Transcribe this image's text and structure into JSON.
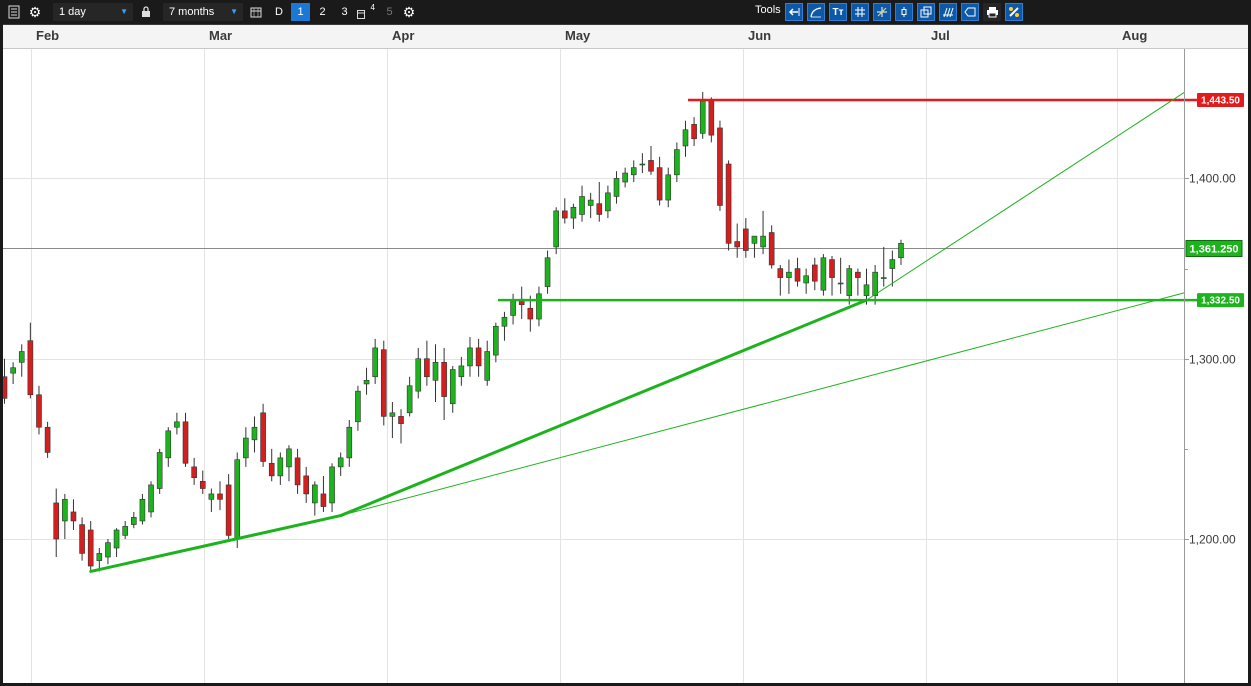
{
  "toolbar": {
    "interval": "1 day",
    "range": "7 months",
    "d_label": "D",
    "layouts": [
      "1",
      "2",
      "3",
      "4",
      "5"
    ],
    "tools_label": "Tools",
    "text_tool_label": "Tт",
    "icons": [
      "list-icon",
      "gear-icon",
      "lock-icon",
      "calendar-icon",
      "gear-icon",
      "arrow-left-icon",
      "curve-icon",
      "text-icon",
      "grid-icon",
      "crosshair-icon",
      "candle-icon",
      "window-icon",
      "fork-icon",
      "tag-icon",
      "print-icon",
      "settings-icon"
    ]
  },
  "chart_data": {
    "type": "candlestick",
    "x_axis_labels": [
      "Feb",
      "Mar",
      "Apr",
      "May",
      "Jun",
      "Jul",
      "Aug"
    ],
    "y_axis_labels": [
      "1,400.00",
      "1,300.00",
      "1,200.00"
    ],
    "y_ticks": [
      1400,
      1300,
      1200
    ],
    "ylim": [
      1111,
      1470
    ],
    "current_price_label": "1,361.250",
    "current_price": 1361.25,
    "horizontal_lines": [
      {
        "label": "1,443.50",
        "value": 1443.5,
        "color": "#e3191b"
      },
      {
        "label": "1,332.50",
        "value": 1332.5,
        "color": "#1db31d"
      }
    ],
    "colors": {
      "up": "#1db31d",
      "down": "#d41f1f",
      "wick": "#333333",
      "trend": "#1db31d",
      "grid": "#e3e3e3"
    },
    "candles_ohlc": [
      [
        1290,
        1300,
        1275,
        1278
      ],
      [
        1292,
        1298,
        1286,
        1295
      ],
      [
        1298,
        1308,
        1290,
        1304
      ],
      [
        1310,
        1320,
        1278,
        1280
      ],
      [
        1280,
        1285,
        1258,
        1262
      ],
      [
        1262,
        1265,
        1245,
        1248
      ],
      [
        1220,
        1228,
        1190,
        1200
      ],
      [
        1210,
        1225,
        1200,
        1222
      ],
      [
        1215,
        1222,
        1205,
        1210
      ],
      [
        1208,
        1212,
        1188,
        1192
      ],
      [
        1205,
        1210,
        1182,
        1185
      ],
      [
        1188,
        1195,
        1182,
        1192
      ],
      [
        1190,
        1200,
        1186,
        1198
      ],
      [
        1195,
        1206,
        1190,
        1205
      ],
      [
        1202,
        1210,
        1200,
        1207
      ],
      [
        1208,
        1215,
        1206,
        1212
      ],
      [
        1210,
        1225,
        1208,
        1222
      ],
      [
        1215,
        1232,
        1212,
        1230
      ],
      [
        1228,
        1250,
        1225,
        1248
      ],
      [
        1245,
        1262,
        1240,
        1260
      ],
      [
        1262,
        1270,
        1258,
        1265
      ],
      [
        1265,
        1270,
        1240,
        1242
      ],
      [
        1240,
        1245,
        1230,
        1234
      ],
      [
        1232,
        1238,
        1225,
        1228
      ],
      [
        1222,
        1228,
        1215,
        1225
      ],
      [
        1225,
        1232,
        1216,
        1222
      ],
      [
        1230,
        1236,
        1200,
        1202
      ],
      [
        1200,
        1248,
        1195,
        1244
      ],
      [
        1245,
        1262,
        1240,
        1256
      ],
      [
        1255,
        1268,
        1248,
        1262
      ],
      [
        1270,
        1275,
        1240,
        1243
      ],
      [
        1242,
        1250,
        1232,
        1235
      ],
      [
        1235,
        1248,
        1230,
        1245
      ],
      [
        1240,
        1252,
        1232,
        1250
      ],
      [
        1245,
        1250,
        1225,
        1230
      ],
      [
        1235,
        1240,
        1220,
        1225
      ],
      [
        1220,
        1232,
        1213,
        1230
      ],
      [
        1225,
        1235,
        1215,
        1218
      ],
      [
        1220,
        1242,
        1215,
        1240
      ],
      [
        1240,
        1248,
        1235,
        1245
      ],
      [
        1245,
        1266,
        1240,
        1262
      ],
      [
        1265,
        1285,
        1260,
        1282
      ],
      [
        1286,
        1295,
        1280,
        1288
      ],
      [
        1290,
        1311,
        1286,
        1306
      ],
      [
        1305,
        1310,
        1263,
        1268
      ],
      [
        1268,
        1276,
        1256,
        1270
      ],
      [
        1268,
        1272,
        1253,
        1264
      ],
      [
        1270,
        1290,
        1268,
        1285
      ],
      [
        1282,
        1306,
        1278,
        1300
      ],
      [
        1300,
        1310,
        1285,
        1290
      ],
      [
        1288,
        1308,
        1276,
        1298
      ],
      [
        1298,
        1306,
        1266,
        1279
      ],
      [
        1275,
        1296,
        1270,
        1294
      ],
      [
        1290,
        1301,
        1285,
        1296
      ],
      [
        1296,
        1312,
        1290,
        1306
      ],
      [
        1306,
        1311,
        1290,
        1296
      ],
      [
        1288,
        1310,
        1285,
        1304
      ],
      [
        1302,
        1320,
        1298,
        1318
      ],
      [
        1318,
        1326,
        1310,
        1323
      ],
      [
        1324,
        1336,
        1319,
        1332
      ],
      [
        1333,
        1340,
        1322,
        1330
      ],
      [
        1328,
        1335,
        1315,
        1322
      ],
      [
        1322,
        1340,
        1318,
        1336
      ],
      [
        1340,
        1360,
        1336,
        1356
      ],
      [
        1362,
        1384,
        1358,
        1382
      ],
      [
        1382,
        1389,
        1375,
        1378
      ],
      [
        1378,
        1386,
        1372,
        1384
      ],
      [
        1380,
        1396,
        1376,
        1390
      ],
      [
        1385,
        1392,
        1378,
        1388
      ],
      [
        1386,
        1398,
        1376,
        1380
      ],
      [
        1382,
        1396,
        1378,
        1392
      ],
      [
        1390,
        1404,
        1386,
        1400
      ],
      [
        1398,
        1406,
        1395,
        1403
      ],
      [
        1402,
        1410,
        1398,
        1406
      ],
      [
        1408,
        1414,
        1403,
        1408
      ],
      [
        1410,
        1418,
        1402,
        1404
      ],
      [
        1406,
        1412,
        1385,
        1388
      ],
      [
        1388,
        1406,
        1384,
        1402
      ],
      [
        1402,
        1420,
        1398,
        1416
      ],
      [
        1418,
        1432,
        1412,
        1427
      ],
      [
        1430,
        1434,
        1418,
        1422
      ],
      [
        1425,
        1448,
        1422,
        1443
      ],
      [
        1443,
        1445,
        1420,
        1424
      ],
      [
        1428,
        1432,
        1382,
        1385
      ],
      [
        1408,
        1410,
        1360,
        1364
      ],
      [
        1365,
        1375,
        1356,
        1362
      ],
      [
        1372,
        1378,
        1356,
        1360
      ],
      [
        1364,
        1368,
        1356,
        1368
      ],
      [
        1362,
        1382,
        1358,
        1368
      ],
      [
        1370,
        1374,
        1350,
        1352
      ],
      [
        1350,
        1352,
        1335,
        1345
      ],
      [
        1345,
        1355,
        1336,
        1348
      ],
      [
        1350,
        1356,
        1340,
        1343
      ],
      [
        1342,
        1350,
        1336,
        1346
      ],
      [
        1352,
        1356,
        1338,
        1343
      ],
      [
        1338,
        1358,
        1335,
        1356
      ],
      [
        1355,
        1357,
        1335,
        1345
      ],
      [
        1342,
        1356,
        1336,
        1342
      ],
      [
        1335,
        1352,
        1330,
        1350
      ],
      [
        1348,
        1350,
        1335,
        1345
      ],
      [
        1335,
        1350,
        1330,
        1341
      ],
      [
        1335,
        1352,
        1330,
        1348
      ],
      [
        1345,
        1362,
        1340,
        1345
      ],
      [
        1350,
        1360,
        1340,
        1355
      ],
      [
        1356,
        1366,
        1352,
        1364
      ]
    ]
  }
}
